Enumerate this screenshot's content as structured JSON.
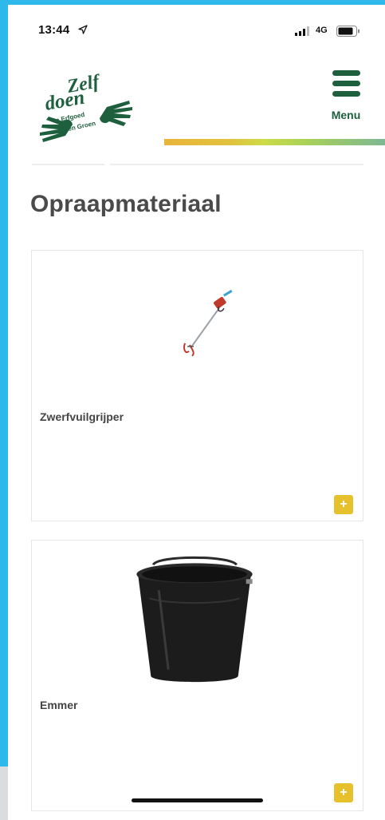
{
  "status_bar": {
    "time": "13:44",
    "network": "4G",
    "icons": [
      "location-arrow-icon",
      "signal-icon",
      "battery-icon"
    ]
  },
  "header": {
    "logo": {
      "line1": "Zelf",
      "line2": "doen",
      "line3": "in Erfgoed",
      "line4": "en Groen"
    },
    "menu_label": "Menu",
    "menu_icon": "hamburger-icon"
  },
  "page": {
    "title": "Opraapmateriaal"
  },
  "products": [
    {
      "name": "Zwerfvuilgrijper",
      "add_label": "+",
      "image": "litter-picker-image"
    },
    {
      "name": "Emmer",
      "add_label": "+",
      "image": "bucket-image"
    }
  ],
  "colors": {
    "brand_green": "#1e5f3e",
    "accent_yellow": "#e7c12b",
    "title_gray": "#4a4a4a",
    "screen_border_blue": "#2fb8ea"
  }
}
